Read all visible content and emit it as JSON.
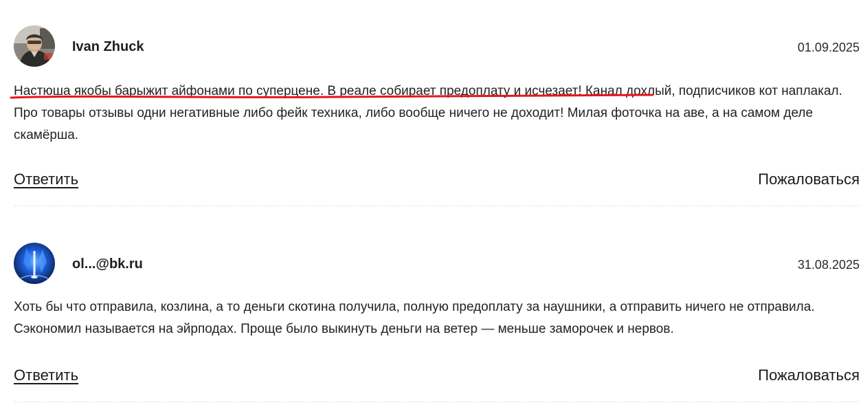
{
  "comments": [
    {
      "author": "Ivan Zhuck",
      "date": "01.09.2025",
      "avatar_icon": "user-photo-avatar",
      "text_highlighted": "Настюша якобы барыжит айфонами по суперцене. В реале собирает предоплату и исчезает!",
      "text_rest": " Канал дохлый, подписчиков кот наплакал. Про товары отзывы одни негативные либо фейк техника, либо вообще ничего не доходит! Милая фоточка на аве, а на самом деле скамёрша.",
      "highlight_color": "#e8141a",
      "reply_label": "Ответить",
      "report_label": "Пожаловаться"
    },
    {
      "author": "ol...@bk.ru",
      "date": "31.08.2025",
      "avatar_icon": "blue-abstract-avatar",
      "text": "Хоть бы что отправила, козлина, а то деньги скотина получила, полную предоплату за наушники, а отправить ничего не отправила. Сэкономил называется на эйрподах. Проще было выкинуть деньги на ветер — меньше заморочек и нервов.",
      "reply_label": "Ответить",
      "report_label": "Пожаловаться"
    }
  ]
}
